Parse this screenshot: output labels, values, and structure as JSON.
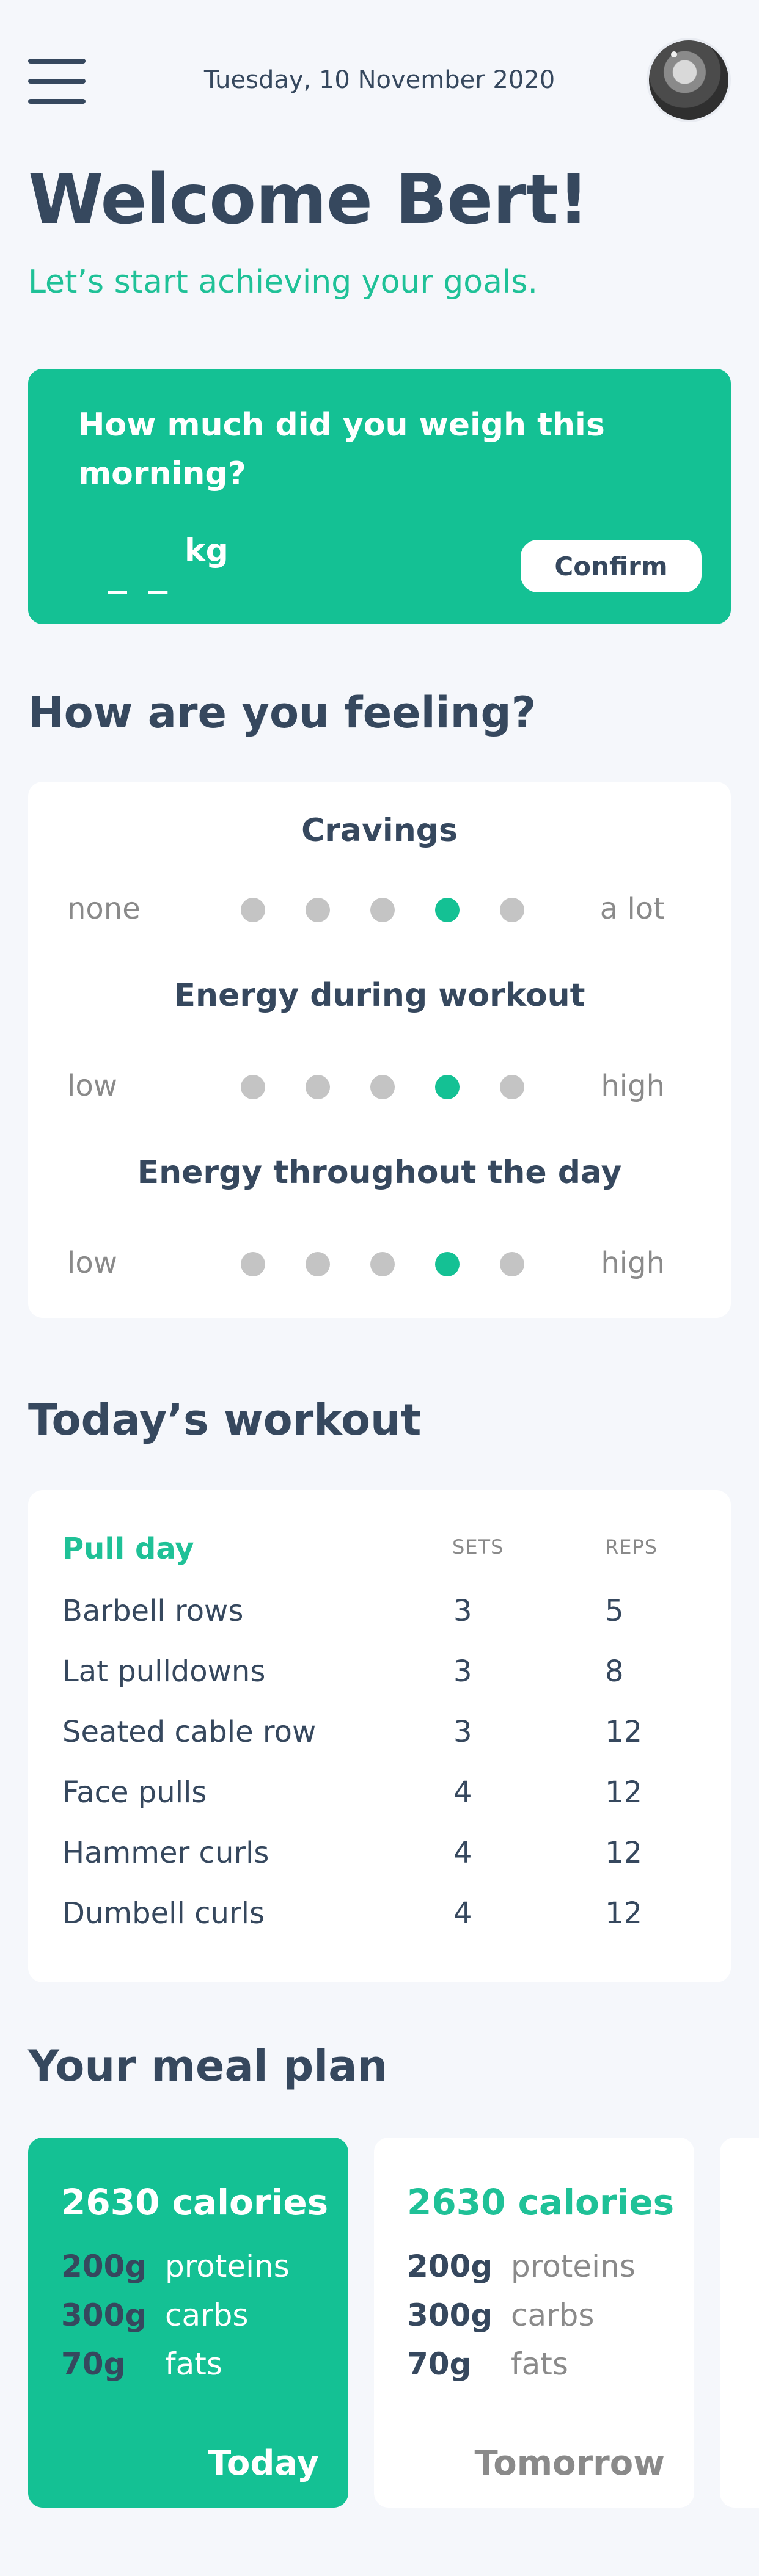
{
  "header": {
    "date": "Tuesday, 10 November 2020",
    "menu_icon": "hamburger-menu-icon",
    "avatar": "user-avatar"
  },
  "greeting": {
    "title": "Welcome Bert!",
    "subtitle": "Let’s start achieving your goals."
  },
  "weight": {
    "question": "How much did you weigh this morning?",
    "value": "_ _",
    "unit": "kg",
    "confirm_label": "Confirm"
  },
  "feelings": {
    "title": "How are you feeling?",
    "scales": [
      {
        "label": "Cravings",
        "low": "none",
        "high": "a lot",
        "selected": 4,
        "max": 5
      },
      {
        "label": "Energy during workout",
        "low": "low",
        "high": "high",
        "selected": 4,
        "max": 5
      },
      {
        "label": "Energy throughout the day",
        "low": "low",
        "high": "high",
        "selected": 4,
        "max": 5
      }
    ]
  },
  "workout": {
    "title": "Today’s workout",
    "day": "Pull day",
    "col_sets": "SETS",
    "col_reps": "REPS",
    "exercises": [
      {
        "name": "Barbell rows",
        "sets": "3",
        "reps": "5"
      },
      {
        "name": "Lat pulldowns",
        "sets": "3",
        "reps": "8"
      },
      {
        "name": "Seated cable row",
        "sets": "3",
        "reps": "12"
      },
      {
        "name": "Face pulls",
        "sets": "4",
        "reps": "12"
      },
      {
        "name": "Hammer curls",
        "sets": "4",
        "reps": "12"
      },
      {
        "name": "Dumbell curls",
        "sets": "4",
        "reps": "12"
      }
    ]
  },
  "meal_plan": {
    "title": "Your meal plan",
    "cards": [
      {
        "calories": "2630 calories",
        "proteins_amt": "200g",
        "proteins": "proteins",
        "carbs_amt": "300g",
        "carbs": "carbs",
        "fats_amt": "70g",
        "fats": "fats",
        "day": "Today"
      },
      {
        "calories": "2630 calories",
        "proteins_amt": "200g",
        "proteins": "proteins",
        "carbs_amt": "300g",
        "carbs": "carbs",
        "fats_amt": "70g",
        "fats": "fats",
        "day": "Tomorrow"
      }
    ]
  },
  "colors": {
    "accent": "#14c194",
    "text_dark": "#36485e",
    "muted": "#8a8a8a",
    "dot_inactive": "#c4c4c4",
    "background": "#f5f7fb"
  }
}
